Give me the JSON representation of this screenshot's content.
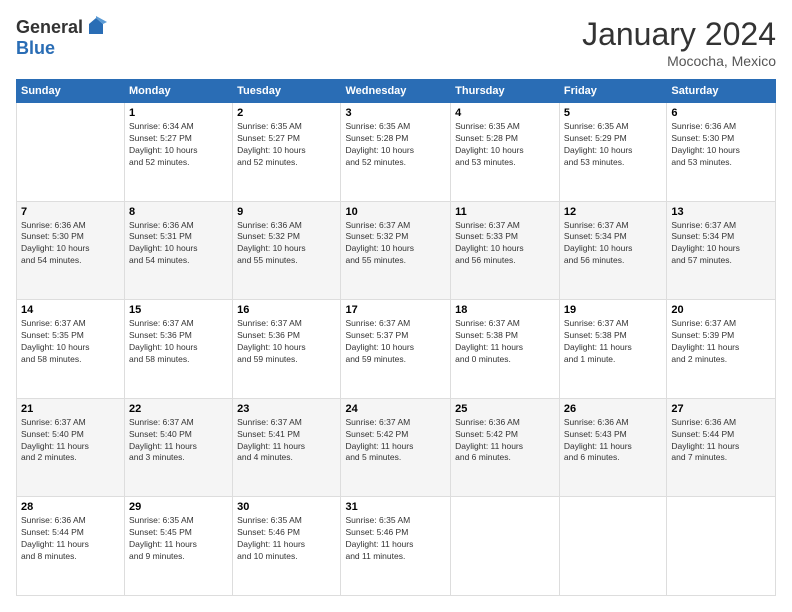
{
  "logo": {
    "general": "General",
    "blue": "Blue"
  },
  "title": "January 2024",
  "location": "Mococha, Mexico",
  "days_header": [
    "Sunday",
    "Monday",
    "Tuesday",
    "Wednesday",
    "Thursday",
    "Friday",
    "Saturday"
  ],
  "weeks": [
    [
      {
        "day": "",
        "info": ""
      },
      {
        "day": "1",
        "info": "Sunrise: 6:34 AM\nSunset: 5:27 PM\nDaylight: 10 hours\nand 52 minutes."
      },
      {
        "day": "2",
        "info": "Sunrise: 6:35 AM\nSunset: 5:27 PM\nDaylight: 10 hours\nand 52 minutes."
      },
      {
        "day": "3",
        "info": "Sunrise: 6:35 AM\nSunset: 5:28 PM\nDaylight: 10 hours\nand 52 minutes."
      },
      {
        "day": "4",
        "info": "Sunrise: 6:35 AM\nSunset: 5:28 PM\nDaylight: 10 hours\nand 53 minutes."
      },
      {
        "day": "5",
        "info": "Sunrise: 6:35 AM\nSunset: 5:29 PM\nDaylight: 10 hours\nand 53 minutes."
      },
      {
        "day": "6",
        "info": "Sunrise: 6:36 AM\nSunset: 5:30 PM\nDaylight: 10 hours\nand 53 minutes."
      }
    ],
    [
      {
        "day": "7",
        "info": "Sunrise: 6:36 AM\nSunset: 5:30 PM\nDaylight: 10 hours\nand 54 minutes."
      },
      {
        "day": "8",
        "info": "Sunrise: 6:36 AM\nSunset: 5:31 PM\nDaylight: 10 hours\nand 54 minutes."
      },
      {
        "day": "9",
        "info": "Sunrise: 6:36 AM\nSunset: 5:32 PM\nDaylight: 10 hours\nand 55 minutes."
      },
      {
        "day": "10",
        "info": "Sunrise: 6:37 AM\nSunset: 5:32 PM\nDaylight: 10 hours\nand 55 minutes."
      },
      {
        "day": "11",
        "info": "Sunrise: 6:37 AM\nSunset: 5:33 PM\nDaylight: 10 hours\nand 56 minutes."
      },
      {
        "day": "12",
        "info": "Sunrise: 6:37 AM\nSunset: 5:34 PM\nDaylight: 10 hours\nand 56 minutes."
      },
      {
        "day": "13",
        "info": "Sunrise: 6:37 AM\nSunset: 5:34 PM\nDaylight: 10 hours\nand 57 minutes."
      }
    ],
    [
      {
        "day": "14",
        "info": "Sunrise: 6:37 AM\nSunset: 5:35 PM\nDaylight: 10 hours\nand 58 minutes."
      },
      {
        "day": "15",
        "info": "Sunrise: 6:37 AM\nSunset: 5:36 PM\nDaylight: 10 hours\nand 58 minutes."
      },
      {
        "day": "16",
        "info": "Sunrise: 6:37 AM\nSunset: 5:36 PM\nDaylight: 10 hours\nand 59 minutes."
      },
      {
        "day": "17",
        "info": "Sunrise: 6:37 AM\nSunset: 5:37 PM\nDaylight: 10 hours\nand 59 minutes."
      },
      {
        "day": "18",
        "info": "Sunrise: 6:37 AM\nSunset: 5:38 PM\nDaylight: 11 hours\nand 0 minutes."
      },
      {
        "day": "19",
        "info": "Sunrise: 6:37 AM\nSunset: 5:38 PM\nDaylight: 11 hours\nand 1 minute."
      },
      {
        "day": "20",
        "info": "Sunrise: 6:37 AM\nSunset: 5:39 PM\nDaylight: 11 hours\nand 2 minutes."
      }
    ],
    [
      {
        "day": "21",
        "info": "Sunrise: 6:37 AM\nSunset: 5:40 PM\nDaylight: 11 hours\nand 2 minutes."
      },
      {
        "day": "22",
        "info": "Sunrise: 6:37 AM\nSunset: 5:40 PM\nDaylight: 11 hours\nand 3 minutes."
      },
      {
        "day": "23",
        "info": "Sunrise: 6:37 AM\nSunset: 5:41 PM\nDaylight: 11 hours\nand 4 minutes."
      },
      {
        "day": "24",
        "info": "Sunrise: 6:37 AM\nSunset: 5:42 PM\nDaylight: 11 hours\nand 5 minutes."
      },
      {
        "day": "25",
        "info": "Sunrise: 6:36 AM\nSunset: 5:42 PM\nDaylight: 11 hours\nand 6 minutes."
      },
      {
        "day": "26",
        "info": "Sunrise: 6:36 AM\nSunset: 5:43 PM\nDaylight: 11 hours\nand 6 minutes."
      },
      {
        "day": "27",
        "info": "Sunrise: 6:36 AM\nSunset: 5:44 PM\nDaylight: 11 hours\nand 7 minutes."
      }
    ],
    [
      {
        "day": "28",
        "info": "Sunrise: 6:36 AM\nSunset: 5:44 PM\nDaylight: 11 hours\nand 8 minutes."
      },
      {
        "day": "29",
        "info": "Sunrise: 6:35 AM\nSunset: 5:45 PM\nDaylight: 11 hours\nand 9 minutes."
      },
      {
        "day": "30",
        "info": "Sunrise: 6:35 AM\nSunset: 5:46 PM\nDaylight: 11 hours\nand 10 minutes."
      },
      {
        "day": "31",
        "info": "Sunrise: 6:35 AM\nSunset: 5:46 PM\nDaylight: 11 hours\nand 11 minutes."
      },
      {
        "day": "",
        "info": ""
      },
      {
        "day": "",
        "info": ""
      },
      {
        "day": "",
        "info": ""
      }
    ]
  ]
}
